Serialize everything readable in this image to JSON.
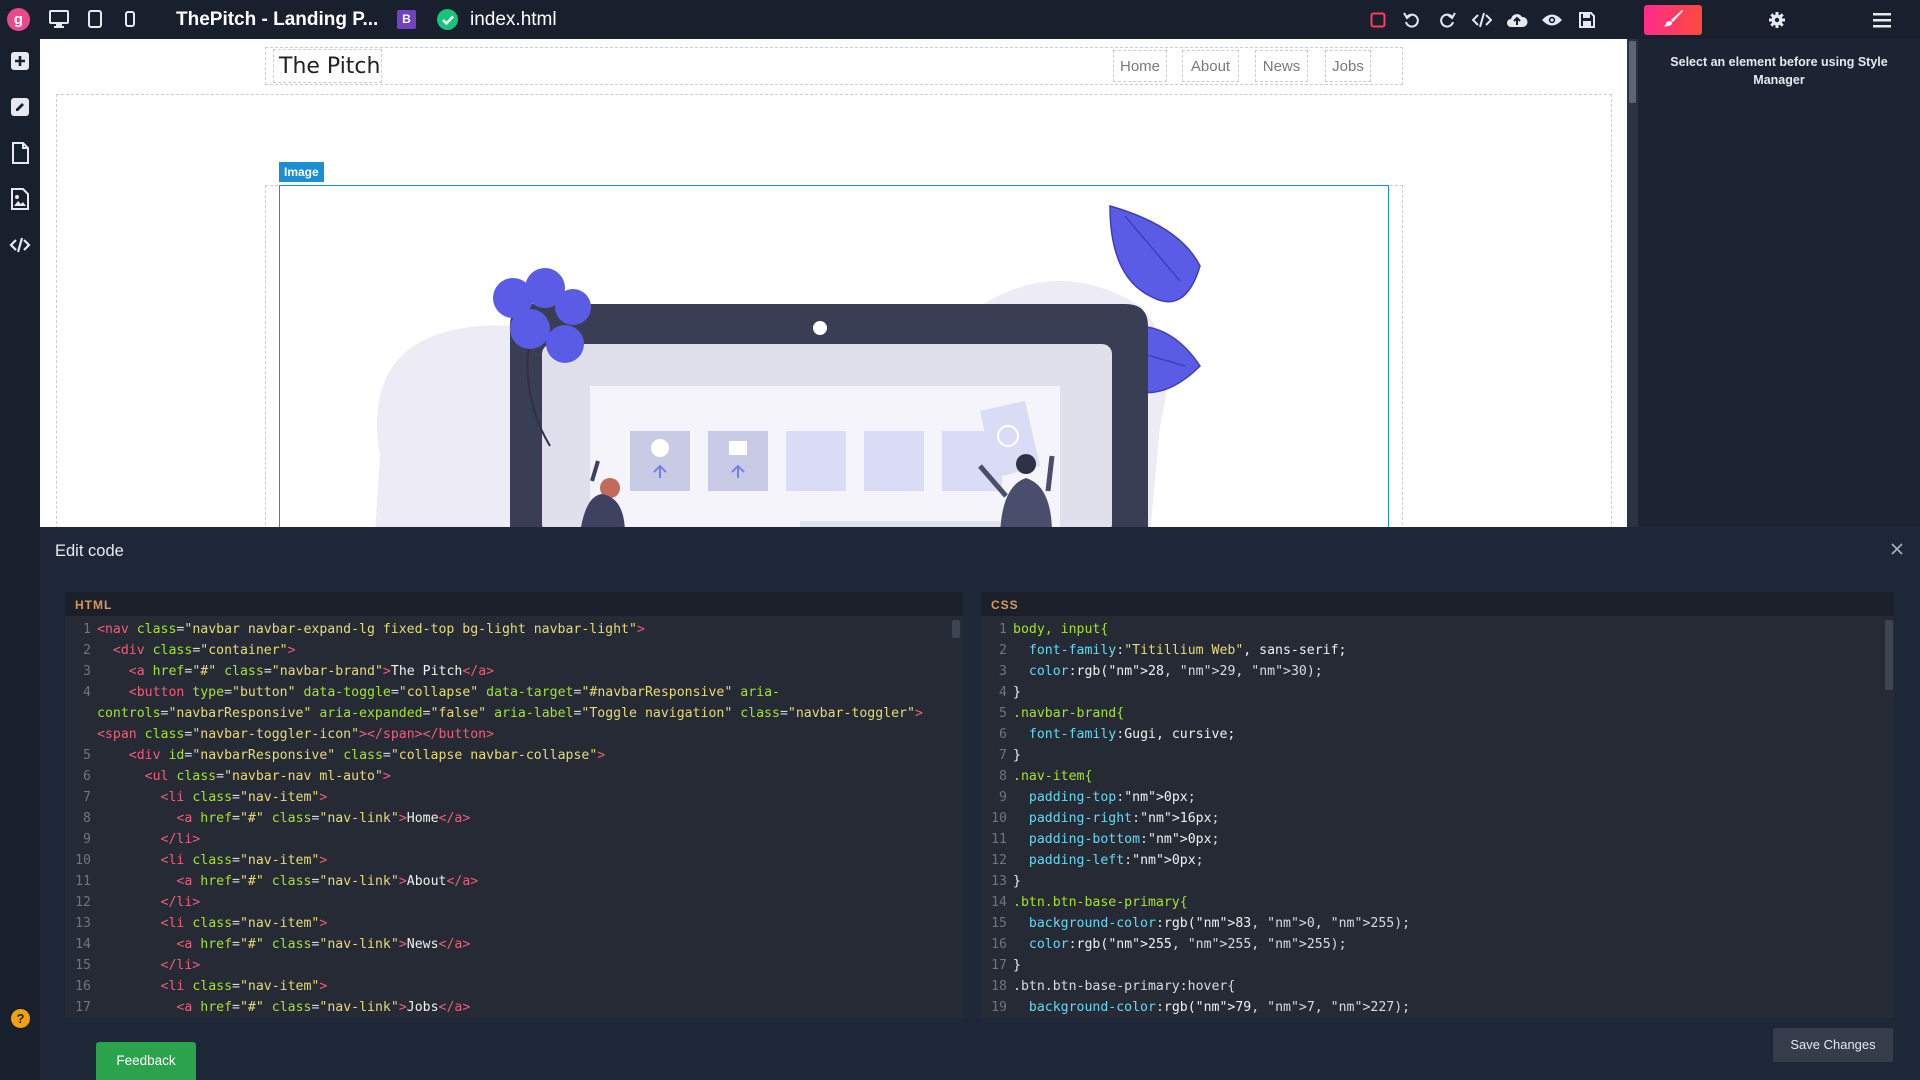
{
  "app": {
    "logo_letter": "g",
    "project_title": "ThePitch - Landing P...",
    "project_badge": "B",
    "file_name": "index.html"
  },
  "toolbar": {
    "device_icons": [
      "desktop-icon",
      "tablet-icon",
      "mobile-icon"
    ],
    "action_icons": [
      "square-outline-icon",
      "undo-icon",
      "redo-icon",
      "code-icon",
      "cloud-upload-icon",
      "eye-icon",
      "save-icon"
    ],
    "style_manager_icon": "paint-brush-icon",
    "settings_icon": "gear-icon",
    "menu_icon": "hamburger-icon"
  },
  "sidebar": {
    "icons": [
      "add-block-icon",
      "edit-icon",
      "page-icon",
      "image-gallery-icon",
      "code-icon"
    ]
  },
  "style_panel": {
    "message": "Select an element before using Style Manager"
  },
  "canvas": {
    "brand": "The Pitch",
    "nav_links": [
      "Home",
      "About",
      "News",
      "Jobs"
    ],
    "selected_label": "Image"
  },
  "editor": {
    "title": "Edit code",
    "html_label": "HTML",
    "css_label": "CSS",
    "save_label": "Save Changes",
    "html_lines": [
      "<nav class=\"navbar navbar-expand-lg fixed-top bg-light navbar-light\">",
      "  <div class=\"container\">",
      "    <a href=\"#\" class=\"navbar-brand\">The Pitch</a>",
      "    <button type=\"button\" data-toggle=\"collapse\" data-target=\"#navbarResponsive\" aria-controls=\"navbarResponsive\" aria-expanded=\"false\" aria-label=\"Toggle navigation\" class=\"navbar-toggler\"><span class=\"navbar-toggler-icon\"></span></button>",
      "    <div id=\"navbarResponsive\" class=\"collapse navbar-collapse\">",
      "      <ul class=\"navbar-nav ml-auto\">",
      "        <li class=\"nav-item\">",
      "          <a href=\"#\" class=\"nav-link\">Home</a>",
      "        </li>",
      "        <li class=\"nav-item\">",
      "          <a href=\"#\" class=\"nav-link\">About</a>",
      "        </li>",
      "        <li class=\"nav-item\">",
      "          <a href=\"#\" class=\"nav-link\">News</a>",
      "        </li>",
      "        <li class=\"nav-item\">",
      "          <a href=\"#\" class=\"nav-link\">Jobs</a>"
    ],
    "css_lines": [
      "body, input{",
      "  font-family:\"Titillium Web\", sans-serif;",
      "  color:rgb(28, 29, 30);",
      "}",
      ".navbar-brand{",
      "  font-family:Gugi, cursive;",
      "}",
      ".nav-item{",
      "  padding-top:0px;",
      "  padding-right:16px;",
      "  padding-bottom:0px;",
      "  padding-left:0px;",
      "}",
      ".btn.btn-base-primary{",
      "  background-color:rgb(83, 0, 255);",
      "  color:rgb(255, 255, 255);",
      "}",
      ".btn.btn-base-primary:hover{",
      "  background-color:rgb(79, 7, 227);"
    ]
  },
  "feedback_label": "Feedback",
  "help_icon": "question-icon",
  "colors": {
    "accent_pink": "#ff2b8a",
    "selection_blue": "#1b8fd2",
    "feedback_green": "#2ba24c",
    "illustration_purple": "#5b5ce6"
  }
}
